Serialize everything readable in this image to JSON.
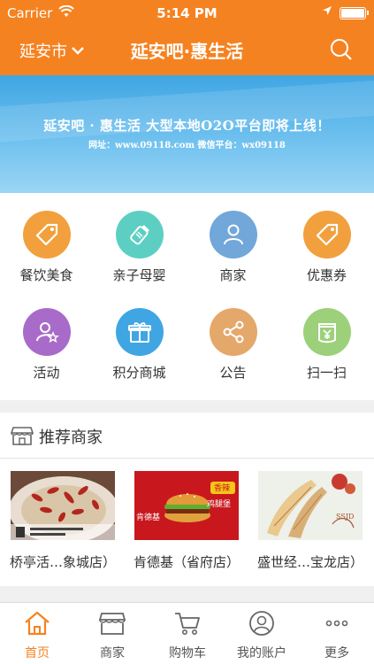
{
  "status_bar": {
    "carrier": "Carrier",
    "time": "5:14 PM"
  },
  "nav": {
    "city": "延安市",
    "title": "延安吧·惠生活"
  },
  "banner": {
    "headline": "延安吧 · 惠生活  大型本地O2O平台即将上线！",
    "subline": "网址：www.09118.com  微信平台：wx09118"
  },
  "categories": [
    {
      "label": "餐饮美食",
      "icon": "tag-icon",
      "color": "#f2a03d"
    },
    {
      "label": "亲子母婴",
      "icon": "baby-bottle-icon",
      "color": "#5ccfc2"
    },
    {
      "label": "商家",
      "icon": "user-icon",
      "color": "#72a7d9"
    },
    {
      "label": "优惠券",
      "icon": "coupon-tag-icon",
      "color": "#f2a03d"
    },
    {
      "label": "活动",
      "icon": "user-star-icon",
      "color": "#a86bc9"
    },
    {
      "label": "积分商城",
      "icon": "gift-icon",
      "color": "#3fa6e3"
    },
    {
      "label": "公告",
      "icon": "share-icon",
      "color": "#e4a86a"
    },
    {
      "label": "扫一扫",
      "icon": "scan-icon",
      "color": "#9dd07a"
    }
  ],
  "recommend": {
    "title": "推荐商家",
    "shops": [
      {
        "name": "桥亭活…象城店）"
      },
      {
        "name": "肯德基（省府店）",
        "img_text_1": "肯德基",
        "img_text_2": "香辣",
        "img_text_3": "鸡腿堡"
      },
      {
        "name": "盛世经…宝龙店）"
      }
    ]
  },
  "tabs": [
    {
      "label": "首页",
      "icon": "home-icon",
      "active": true
    },
    {
      "label": "商家",
      "icon": "shop-icon"
    },
    {
      "label": "购物车",
      "icon": "cart-icon"
    },
    {
      "label": "我的账户",
      "icon": "account-icon"
    },
    {
      "label": "更多",
      "icon": "more-icon"
    }
  ],
  "colors": {
    "brand": "#f58220",
    "tab_active": "#f58220"
  }
}
